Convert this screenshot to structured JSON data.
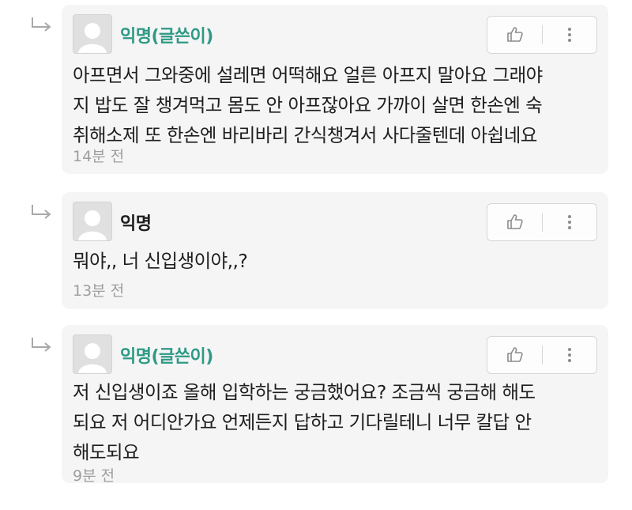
{
  "comments": [
    {
      "author": "익명(글쓴이)",
      "author_color": "#2e9a86",
      "lines": [
        "아프면서 그와중에 설레면 어떡해요 얼른 아프지 말아요 그래야",
        "지 밥도 잘 챙겨먹고 몸도 안 아프잖아요 가까이 살면 한손엔 숙",
        "취해소제 또 한손엔 바리바리 간식챙겨서 사다줄텐데 아쉽네요"
      ],
      "time": "14분 전"
    },
    {
      "author": "익명",
      "author_color": "#1e1e1e",
      "lines": [
        "뭐야,, 너 신입생이야,,?"
      ],
      "time": "13분 전"
    },
    {
      "author": "익명(글쓴이)",
      "author_color": "#2e9a86",
      "lines": [
        "저 신입생이죠 올해 입학하는  궁금했어요? 조금씩 궁금해 해도",
        "되요 저 어디안가요 언제든지 답하고 기다릴테니 너무 칼답 안",
        "해도되요"
      ],
      "time": "9분 전"
    }
  ],
  "icons": {
    "reply": "reply-arrow-icon",
    "like": "thumbs-up-icon",
    "more": "more-vertical-icon",
    "avatar": "default-avatar-icon"
  }
}
